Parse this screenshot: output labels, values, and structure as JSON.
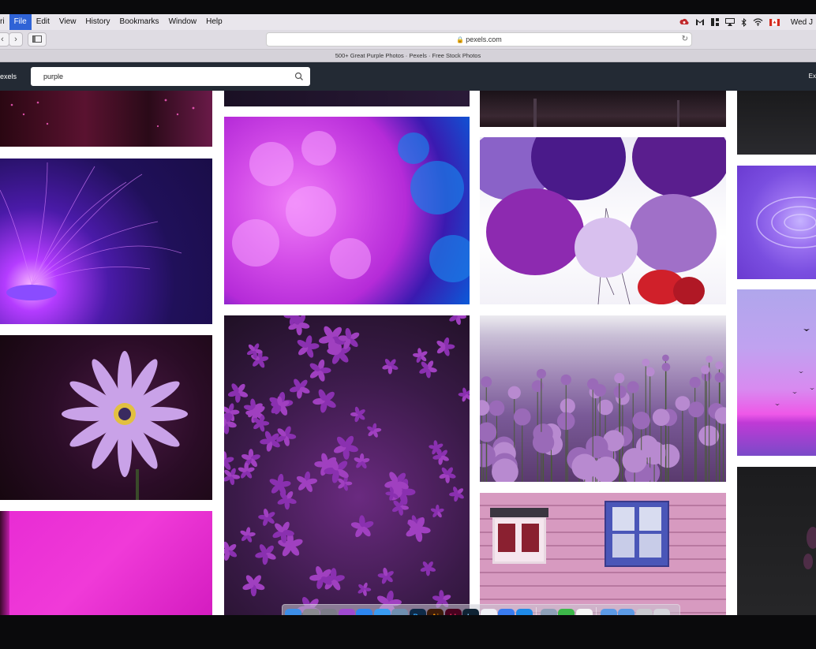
{
  "menubar": {
    "app_name": "ri",
    "items": [
      "File",
      "Edit",
      "View",
      "History",
      "Bookmarks",
      "Window",
      "Help"
    ],
    "clock": "Wed J",
    "status_icons": [
      "creative-cloud-icon",
      "gmail-icon",
      "grid-icon",
      "airplay-icon",
      "bluetooth-icon",
      "wifi-icon",
      "canada-flag-icon"
    ]
  },
  "browser": {
    "url": "pexels.com",
    "tab_title": "500+ Great Purple Photos · Pexels · Free Stock Photos"
  },
  "site": {
    "logo_text": "exels",
    "search_value": "purple",
    "explore_label": "Ex"
  },
  "photos": [
    {
      "name": "photo-pink-lights",
      "desc": "pink light trails"
    },
    {
      "name": "photo-fiber-optic-lamp",
      "desc": "purple fiber optic lamp"
    },
    {
      "name": "photo-purple-daisy",
      "desc": "purple daisy flower"
    },
    {
      "name": "photo-pink-fabric",
      "desc": "magenta fabric"
    },
    {
      "name": "photo-ink-smoke",
      "desc": "purple ink in water"
    },
    {
      "name": "photo-phlox-flowers",
      "desc": "purple phlox flowers"
    },
    {
      "name": "photo-dark-landscape",
      "desc": "dark landscape"
    },
    {
      "name": "photo-balloons",
      "desc": "purple balloons"
    },
    {
      "name": "photo-allium-field",
      "desc": "allium flower field"
    },
    {
      "name": "photo-pink-wall-windows",
      "desc": "pink wooden wall with windows"
    },
    {
      "name": "photo-dark-strip",
      "desc": "dark photo"
    },
    {
      "name": "photo-water-ripple",
      "desc": "purple water ripple"
    },
    {
      "name": "photo-sunset-birds",
      "desc": "purple sunset with birds"
    },
    {
      "name": "photo-dark-plant",
      "desc": "dark plant"
    }
  ],
  "dock": {
    "apps": [
      {
        "name": "finder-icon",
        "label": "",
        "color": "#3d8ee8"
      },
      {
        "name": "system-preferences-icon",
        "label": "",
        "color": "#8a8a90"
      },
      {
        "name": "launchpad-icon",
        "label": "",
        "color": "#7c7c88"
      },
      {
        "name": "siri-icon",
        "label": "",
        "color": "#a04ad0"
      },
      {
        "name": "app-store-icon",
        "label": "",
        "color": "#2d86f0"
      },
      {
        "name": "safari-icon",
        "label": "",
        "color": "#3a9cf2"
      },
      {
        "name": "preview-icon",
        "label": "",
        "color": "#6f8fb0"
      },
      {
        "name": "photoshop-icon",
        "label": "Ps",
        "color": "#0e2a47"
      },
      {
        "name": "illustrator-icon",
        "label": "Ai",
        "color": "#3d1c0a"
      },
      {
        "name": "indesign-icon",
        "label": "Id",
        "color": "#49021f"
      },
      {
        "name": "lightroom-icon",
        "label": "Lr",
        "color": "#0f2334"
      },
      {
        "name": "itunes-icon",
        "label": "",
        "color": "#f0f0f5"
      },
      {
        "name": "messenger-icon",
        "label": "",
        "color": "#3a7cf0"
      },
      {
        "name": "cloud-upload-icon",
        "label": "",
        "color": "#1f8ae8"
      }
    ],
    "apps2": [
      {
        "name": "image-capture-icon",
        "label": "",
        "color": "#8ea0b8"
      },
      {
        "name": "facetime-icon",
        "label": "",
        "color": "#3db84a"
      },
      {
        "name": "document-icon",
        "label": "",
        "color": "#f5f5f5"
      }
    ],
    "apps3": [
      {
        "name": "folder-icon",
        "label": "",
        "color": "#5d9be6"
      },
      {
        "name": "downloads-folder-icon",
        "label": "",
        "color": "#5d9be6"
      },
      {
        "name": "calendar-grid-icon",
        "label": "",
        "color": "#c9c9cf"
      },
      {
        "name": "trash-icon",
        "label": "",
        "color": "#d5d5db"
      }
    ]
  }
}
